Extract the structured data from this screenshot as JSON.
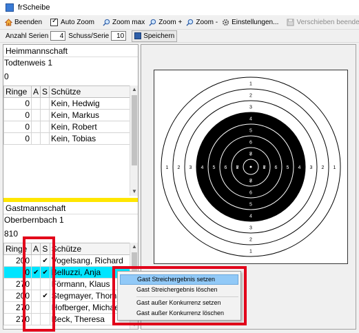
{
  "window": {
    "title": "frScheibe"
  },
  "toolbar": {
    "beenden": "Beenden",
    "auto_zoom": "Auto Zoom",
    "zoom_max": "Zoom max",
    "zoom_plus": "Zoom +",
    "zoom_minus": "Zoom -",
    "einstellungen": "Einstellungen...",
    "verschieben": "Verschieben beenden"
  },
  "toolbar2": {
    "anzahl_serien_label": "Anzahl Serien",
    "anzahl_serien_value": "4",
    "schuss_serie_label": "Schuss/Serie",
    "schuss_serie_value": "10",
    "speichern": "Speichern"
  },
  "heim": {
    "header": "Heimmannschaft",
    "team": "Todtenweis 1",
    "score": "0",
    "columns": {
      "ringe": "Ringe",
      "a": "A",
      "s": "S",
      "schuetze": "Schütze"
    },
    "rows": [
      {
        "ringe": "0",
        "a": "",
        "s": "",
        "name": "Kein, Hedwig"
      },
      {
        "ringe": "0",
        "a": "",
        "s": "",
        "name": "Kein, Markus"
      },
      {
        "ringe": "0",
        "a": "",
        "s": "",
        "name": "Kein, Robert"
      },
      {
        "ringe": "0",
        "a": "",
        "s": "",
        "name": "Kein, Tobias"
      }
    ]
  },
  "gast": {
    "header": "Gastmannschaft",
    "team": "Oberbernbach 1",
    "score": "810",
    "columns": {
      "ringe": "Ringe",
      "a": "A",
      "s": "S",
      "schuetze": "Schütze"
    },
    "rows": [
      {
        "ringe": "200",
        "a": "",
        "s": "✔",
        "name": "Vogelsang, Richard"
      },
      {
        "ringe": "0",
        "a": "✔",
        "s": "✔",
        "name": "Belluzzi, Anja"
      },
      {
        "ringe": "270",
        "a": "",
        "s": "",
        "name": "Förmann, Klaus"
      },
      {
        "ringe": "200",
        "a": "",
        "s": "✔",
        "name": "Stegmayer, Thomas"
      },
      {
        "ringe": "270",
        "a": "",
        "s": "",
        "name": "Hofberger, Michael"
      },
      {
        "ringe": "270",
        "a": "",
        "s": "",
        "name": "Beck, Theresa"
      }
    ]
  },
  "target": {
    "ring_labels_vertical": [
      "1",
      "2",
      "3",
      "4",
      "5",
      "6",
      "7",
      "8"
    ],
    "ring_labels_horizontal": [
      "1",
      "2",
      "3",
      "4",
      "5",
      "6",
      "7",
      "8"
    ]
  },
  "context_menu": {
    "items": [
      "Gast Streichergebnis setzen",
      "Gast Streichergebnis löschen",
      "Gast außer Konkurrenz setzen",
      "Gast außer Konkurrenz löschen"
    ]
  },
  "colors": {
    "highlight": "#e2001a",
    "selection": "#00e5ff",
    "splitter": "#ffe600"
  }
}
